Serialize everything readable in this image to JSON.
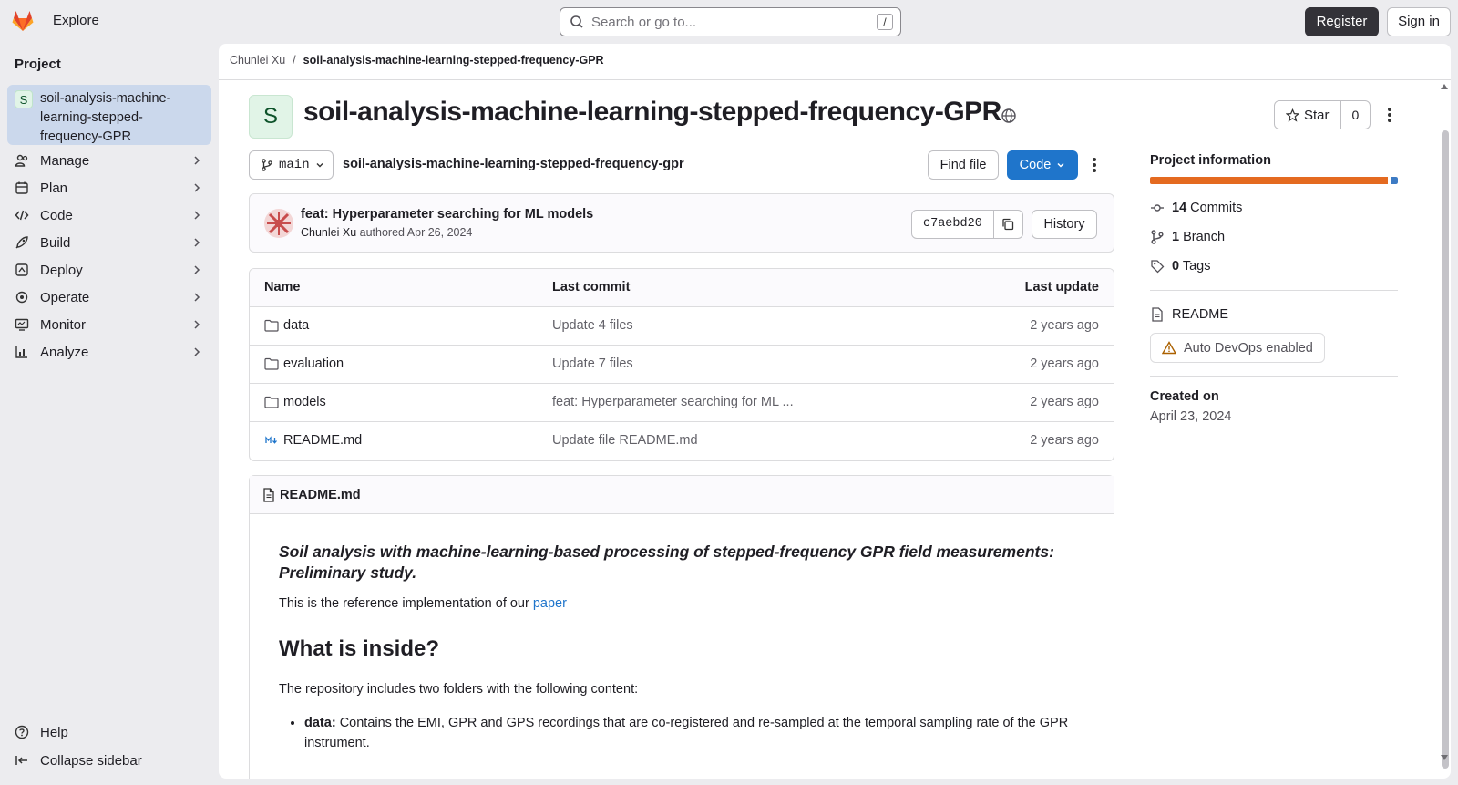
{
  "topbar": {
    "explore": "Explore",
    "search_placeholder": "Search or go to...",
    "search_shortcut": "/",
    "register": "Register",
    "sign_in": "Sign in"
  },
  "sidebar": {
    "heading": "Project",
    "project_avatar": "S",
    "project_name": "soil-analysis-machine-learning-stepped-frequency-GPR",
    "items": [
      {
        "label": "Manage",
        "icon": "users-icon"
      },
      {
        "label": "Plan",
        "icon": "calendar-icon"
      },
      {
        "label": "Code",
        "icon": "code-icon"
      },
      {
        "label": "Build",
        "icon": "rocket-icon"
      },
      {
        "label": "Deploy",
        "icon": "deployments-icon"
      },
      {
        "label": "Operate",
        "icon": "cloud-gear-icon"
      },
      {
        "label": "Monitor",
        "icon": "monitor-icon"
      },
      {
        "label": "Analyze",
        "icon": "chart-icon"
      }
    ],
    "help": "Help",
    "collapse": "Collapse sidebar"
  },
  "breadcrumb": {
    "owner": "Chunlei Xu",
    "separator": "/",
    "project": "soil-analysis-machine-learning-stepped-frequency-GPR"
  },
  "project": {
    "avatar": "S",
    "title": "soil-analysis-machine-learning-stepped-frequency-GPR",
    "star_label": "Star",
    "star_count": "0"
  },
  "repo": {
    "branch": "main",
    "path": "soil-analysis-machine-learning-stepped-frequency-gpr",
    "find_file": "Find file",
    "code": "Code"
  },
  "last_commit": {
    "title": "feat: Hyperparameter searching for ML models",
    "author": "Chunlei Xu",
    "authored": "authored",
    "date": "Apr 26, 2024",
    "sha": "c7aebd20",
    "history": "History"
  },
  "files": {
    "headers": {
      "name": "Name",
      "last_commit": "Last commit",
      "last_update": "Last update"
    },
    "rows": [
      {
        "name": "data",
        "type": "folder",
        "commit": "Update 4 files",
        "updated": "2 years ago"
      },
      {
        "name": "evaluation",
        "type": "folder",
        "commit": "Update 7 files",
        "updated": "2 years ago"
      },
      {
        "name": "models",
        "type": "folder",
        "commit": "feat: Hyperparameter searching for ML ...",
        "updated": "2 years ago"
      },
      {
        "name": "README.md",
        "type": "markdown",
        "commit": "Update file README.md",
        "updated": "2 years ago"
      }
    ]
  },
  "readme": {
    "filename": "README.md",
    "lead": "Soil analysis with machine-learning-based processing of stepped-frequency GPR field measurements: Preliminary study.",
    "intro_prefix": "This is the reference implementation of our",
    "intro_link": "paper",
    "heading": "What is inside?",
    "paragraph": "The repository includes two folders with the following content:",
    "bullet_label": "data:",
    "bullet_text": "Contains the EMI, GPR and GPS recordings that are co-registered and re-sampled at the temporal sampling rate of the GPR instrument."
  },
  "project_info": {
    "title": "Project information",
    "language_bar": [
      {
        "color": "#e46a20",
        "share": 0.97
      },
      {
        "color": "#3d7bc4",
        "share": 0.03
      }
    ],
    "commits_count": "14",
    "commits_label": "Commits",
    "branch_count": "1",
    "branch_label": "Branch",
    "tags_count": "0",
    "tags_label": "Tags",
    "readme": "README",
    "auto_devops": "Auto DevOps enabled",
    "created_label": "Created on",
    "created_date": "April 23, 2024"
  }
}
